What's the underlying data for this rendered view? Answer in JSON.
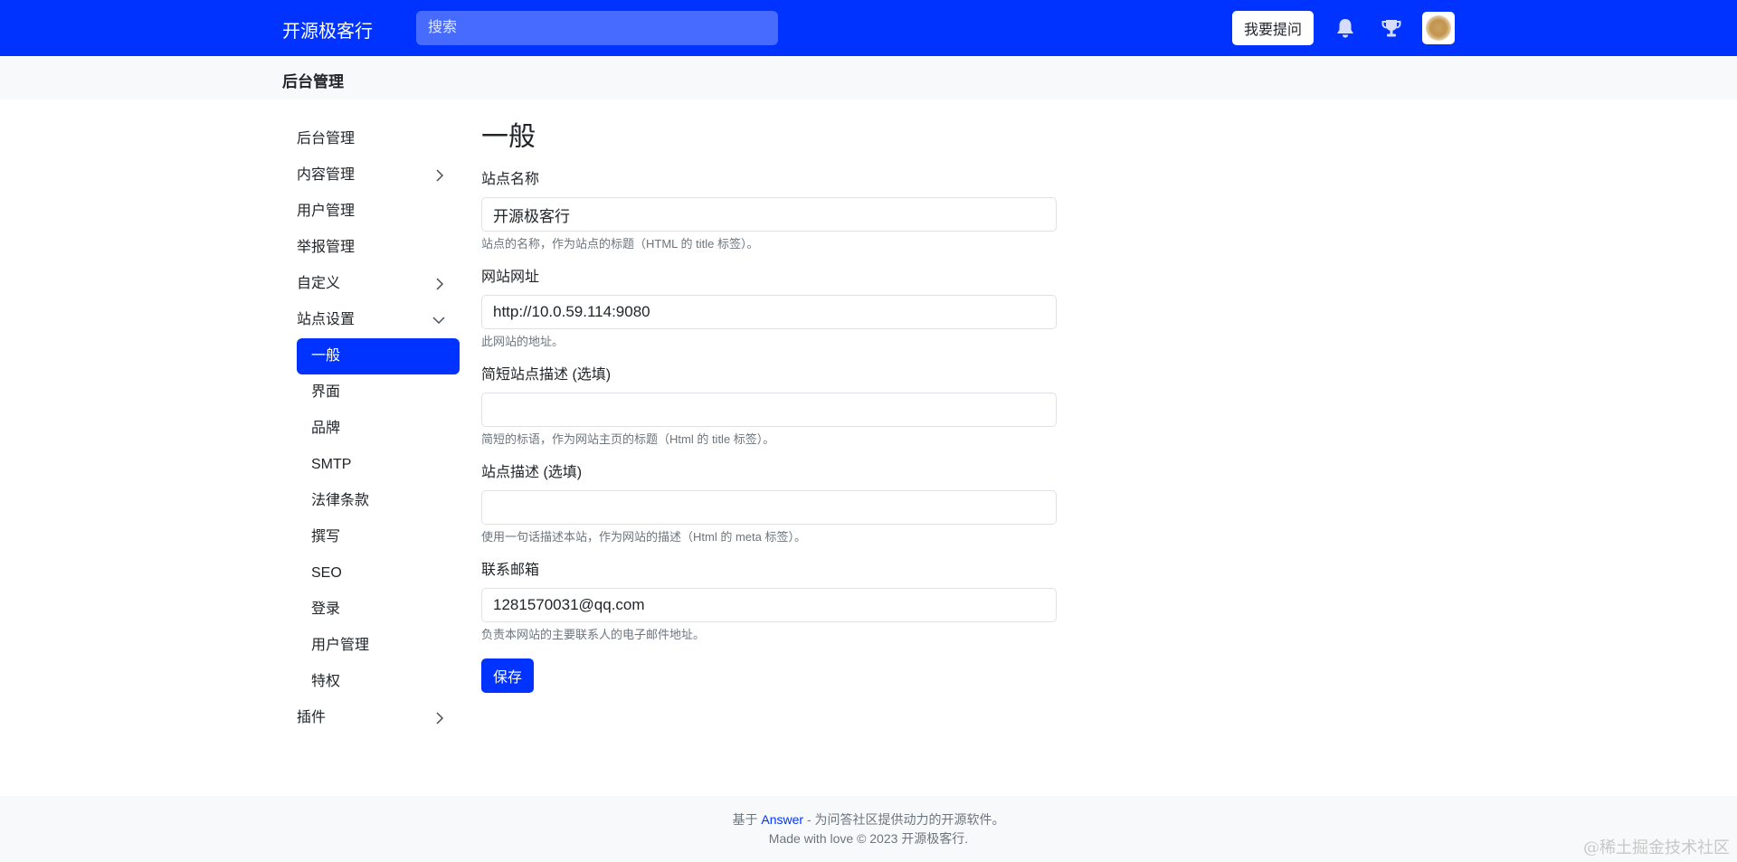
{
  "header": {
    "brand": "开源极客行",
    "search_placeholder": "搜索",
    "ask_button": "我要提问",
    "icons": [
      "bell-icon",
      "trophy-icon"
    ],
    "accent_color": "#0033ff"
  },
  "subheader": {
    "title": "后台管理"
  },
  "sidebar": {
    "items": [
      {
        "label": "后台管理"
      },
      {
        "label": "内容管理",
        "chevron": "right"
      },
      {
        "label": "用户管理"
      },
      {
        "label": "举报管理"
      },
      {
        "label": "自定义",
        "chevron": "right"
      },
      {
        "label": "站点设置",
        "chevron": "down"
      },
      {
        "label": "一般",
        "active": true
      },
      {
        "label": "界面"
      },
      {
        "label": "品牌"
      },
      {
        "label": "SMTP"
      },
      {
        "label": "法律条款"
      },
      {
        "label": "撰写"
      },
      {
        "label": "SEO"
      },
      {
        "label": "登录"
      },
      {
        "label": "用户管理"
      },
      {
        "label": "特权"
      },
      {
        "label": "插件",
        "chevron": "right"
      }
    ]
  },
  "main": {
    "title": "一般",
    "fields": [
      {
        "label": "站点名称",
        "value": "开源极客行",
        "help": "站点的名称，作为站点的标题（HTML 的 title 标签）。"
      },
      {
        "label": "网站网址",
        "value": "http://10.0.59.114:9080",
        "help": "此网站的地址。"
      },
      {
        "label": "简短站点描述 (选填)",
        "value": "",
        "help": "简短的标语，作为网站主页的标题（Html 的 title 标签）。"
      },
      {
        "label": "站点描述 (选填)",
        "value": "",
        "help": "使用一句话描述本站，作为网站的描述（Html 的 meta 标签）。"
      },
      {
        "label": "联系邮箱",
        "value": "1281570031@qq.com",
        "help": "负责本网站的主要联系人的电子邮件地址。"
      }
    ],
    "save_button": "保存"
  },
  "footer": {
    "prefix": "基于",
    "link": "Answer",
    "suffix": "- 为问答社区提供动力的开源软件。",
    "line2": "Made with love © 2023 开源极客行.",
    "watermark": "@稀土掘金技术社区"
  }
}
